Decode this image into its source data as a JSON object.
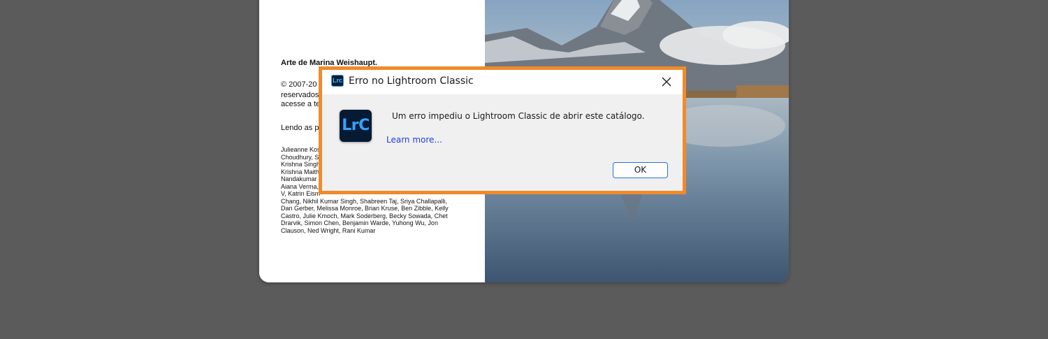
{
  "splash": {
    "artist_credit": "Arte de Marina Weishaupt.",
    "copyright_lines": [
      "© 2007-20",
      "reservados",
      "acesse a te"
    ],
    "reading_prefix": "Lendo as p",
    "contributors_lines": [
      "Julieanne Kos",
      "Choudhury, S",
      "Krishna Singh",
      "Krishna Maith",
      "Nandakumar",
      "Aiana Verma,",
      "V, Katrin Eism",
      "Chang, Nikhil Kumar Singh, Shabreen Taj, Sriya Challapalli,",
      "Dan Gerber, Melissa Monroe, Brian Kruse, Ben Zibble, Kelly",
      "Castro, Julie Kmoch, Mark Soderberg, Becky Sowada, Chet",
      "Drarvik, Simon Chen, Benjamin Warde, Yuhong Wu, Jon",
      "Clauson, Ned Wright, Rani Kumar"
    ]
  },
  "dialog": {
    "title": "Erro no Lightroom Classic",
    "title_icon_text": "Lrc",
    "close_glyph": "✕",
    "app_icon_text": "LrC",
    "message": "Um erro impediu o Lightroom Classic de abrir este catálogo.",
    "learn_more": "Learn more...",
    "ok_label": "OK"
  },
  "colors": {
    "highlight_border": "#f08a2c",
    "link": "#1e3de0",
    "app_icon_bg": "#061a33",
    "app_icon_fg": "#36a3ff"
  }
}
